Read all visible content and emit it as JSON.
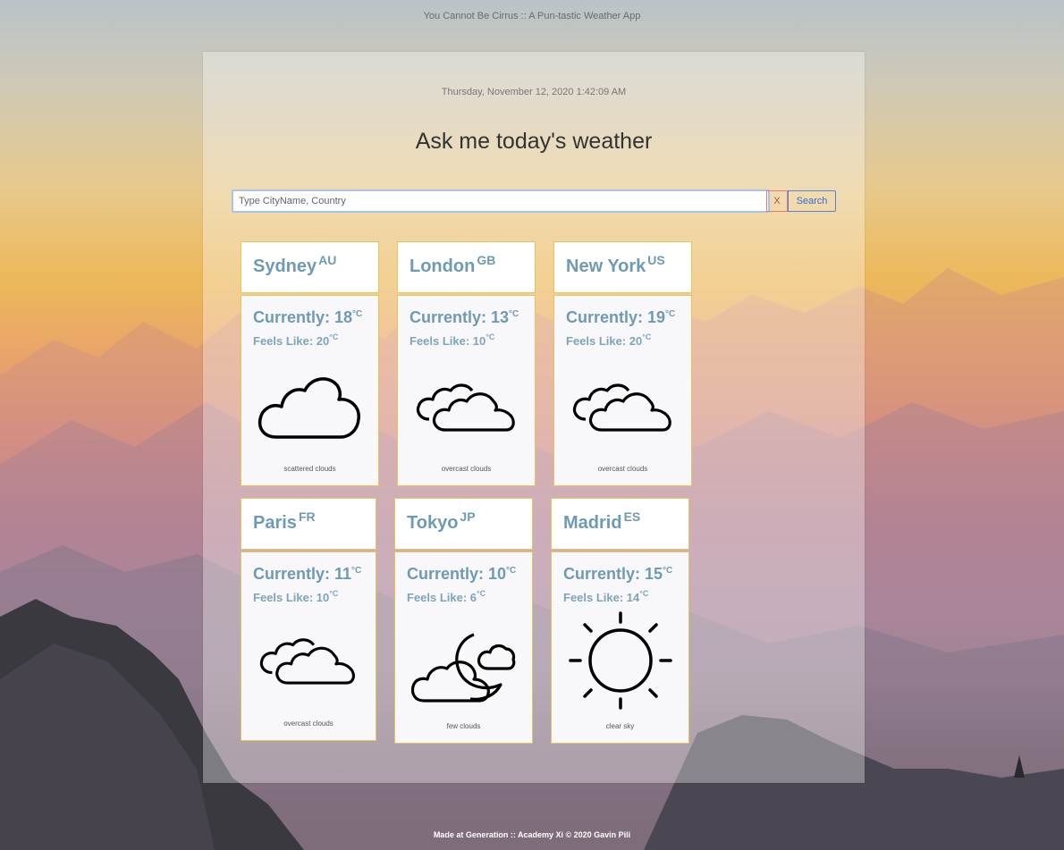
{
  "app": {
    "title": "You Cannot Be Cirrus :: A Pun-tastic Weather App"
  },
  "datetime": "Thursday, November 12, 2020 1:42:09 AM",
  "heading": "Ask me today's weather",
  "search": {
    "placeholder": "Type CityName, Country",
    "value": "",
    "clear_label": "X",
    "submit_label": "Search"
  },
  "cities": [
    {
      "name": "Sydney",
      "country": "AU",
      "current_label": "Currently: 18",
      "feels_label": "Feels Like: 20",
      "unit": "°C",
      "description": "scattered clouds",
      "icon": "cloud-icon"
    },
    {
      "name": "London",
      "country": "GB",
      "current_label": "Currently: 13",
      "feels_label": "Feels Like: 10",
      "unit": "°C",
      "description": "overcast clouds",
      "icon": "double-cloud-icon"
    },
    {
      "name": "New York",
      "country": "US",
      "current_label": "Currently: 19",
      "feels_label": "Feels Like: 20",
      "unit": "°C",
      "description": "overcast clouds",
      "icon": "double-cloud-icon"
    },
    {
      "name": "Paris",
      "country": "FR",
      "current_label": "Currently: 11",
      "feels_label": "Feels Like: 10",
      "unit": "°C",
      "description": "overcast clouds",
      "icon": "double-cloud-icon"
    },
    {
      "name": "Tokyo",
      "country": "JP",
      "current_label": "Currently: 10",
      "feels_label": "Feels Like: 6",
      "unit": "°C",
      "description": "few clouds",
      "icon": "moon-cloud-icon"
    },
    {
      "name": "Madrid",
      "country": "ES",
      "current_label": "Currently: 15",
      "feels_label": "Feels Like: 14",
      "unit": "°C",
      "description": "clear sky",
      "icon": "sun-icon"
    }
  ],
  "footer": "Made at Generation :: Academy Xi © 2020 Gavin Pili",
  "colors": {
    "card_border": "#e8c55a",
    "card_text": "#6e9ab4",
    "search_button": "#5a82d0",
    "clear_button": "#e07a7a"
  }
}
